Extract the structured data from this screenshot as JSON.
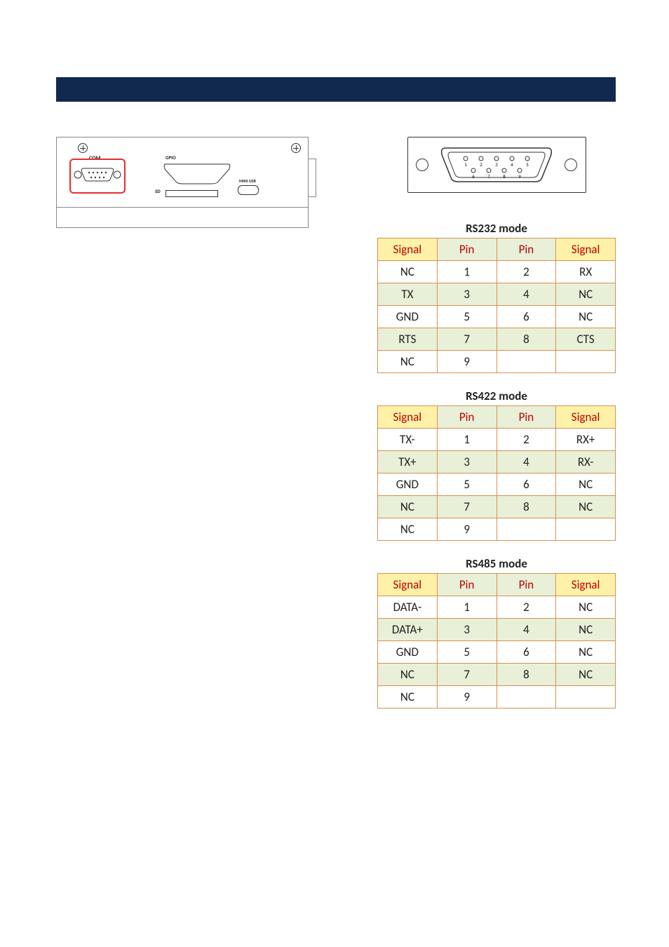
{
  "device": {
    "com_label": "COM",
    "gpio_label": "GPIO",
    "sd_label": "SD",
    "miniusb_label": "MINI USB"
  },
  "db9_pins": [
    "1",
    "2",
    "3",
    "4",
    "5",
    "6",
    "7",
    "8",
    "9"
  ],
  "tables": [
    {
      "title": "RS232 mode",
      "headers": [
        "Signal",
        "Pin",
        "Pin",
        "Signal"
      ],
      "rows": [
        [
          "NC",
          "1",
          "2",
          "RX"
        ],
        [
          "TX",
          "3",
          "4",
          "NC"
        ],
        [
          "GND",
          "5",
          "6",
          "NC"
        ],
        [
          "RTS",
          "7",
          "8",
          "CTS"
        ],
        [
          "NC",
          "9",
          "",
          ""
        ]
      ]
    },
    {
      "title": "RS422 mode",
      "headers": [
        "Signal",
        "Pin",
        "Pin",
        "Signal"
      ],
      "rows": [
        [
          "TX-",
          "1",
          "2",
          "RX+"
        ],
        [
          "TX+",
          "3",
          "4",
          "RX-"
        ],
        [
          "GND",
          "5",
          "6",
          "NC"
        ],
        [
          "NC",
          "7",
          "8",
          "NC"
        ],
        [
          "NC",
          "9",
          "",
          ""
        ]
      ]
    },
    {
      "title": "RS485 mode",
      "headers": [
        "Signal",
        "Pin",
        "Pin",
        "Signal"
      ],
      "rows": [
        [
          "DATA-",
          "1",
          "2",
          "NC"
        ],
        [
          "DATA+",
          "3",
          "4",
          "NC"
        ],
        [
          "GND",
          "5",
          "6",
          "NC"
        ],
        [
          "NC",
          "7",
          "8",
          "NC"
        ],
        [
          "NC",
          "9",
          "",
          ""
        ]
      ]
    }
  ]
}
